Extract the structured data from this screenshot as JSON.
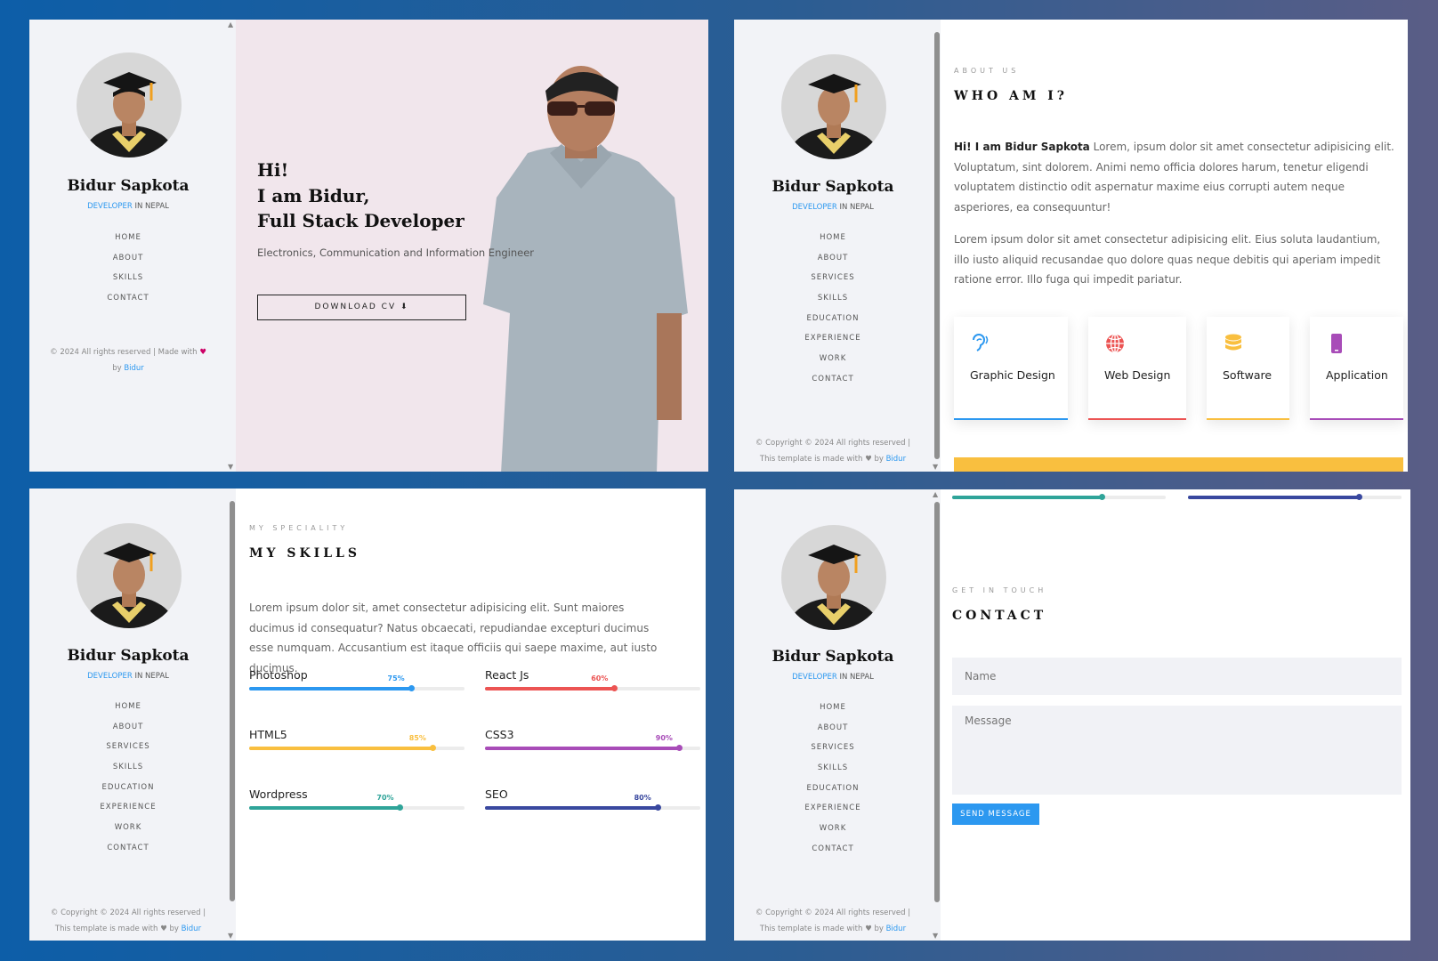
{
  "sidebar": {
    "name": "Bidur Sapkota",
    "role_highlight": "DEVELOPER",
    "role_rest": " IN NEPAL",
    "nav_short": [
      "HOME",
      "ABOUT",
      "SKILLS",
      "CONTACT"
    ],
    "nav_full": [
      "HOME",
      "ABOUT",
      "SERVICES",
      "SKILLS",
      "EDUCATION",
      "EXPERIENCE",
      "WORK",
      "CONTACT"
    ],
    "footer_short_1": "© 2024 All rights reserved | Made with",
    "footer_short_by": "by ",
    "footer_author": "Bidur",
    "footer_long_1": "© Copyright © 2024 All rights reserved |",
    "footer_long_2": "This template is made with",
    "footer_long_by": " by "
  },
  "hero": {
    "line1": "Hi!",
    "line2": "I am Bidur,",
    "line3": "Full Stack Developer",
    "subtitle": "Electronics, Communication and Information Engineer",
    "cta_label": "DOWNLOAD CV",
    "background_color": "#f1e6ec"
  },
  "about": {
    "eyebrow": "ABOUT US",
    "heading": "WHO AM I?",
    "intro_bold": "Hi! I am Bidur Sapkota",
    "para1": " Lorem, ipsum dolor sit amet consectetur adipisicing elit. Voluptatum, sint dolorem. Animi nemo officia dolores harum, tenetur eligendi voluptatem distinctio odit aspernatur maxime eius corrupti autem neque asperiores, ea consequuntur!",
    "para2": "Lorem ipsum dolor sit amet consectetur adipisicing elit. Eius soluta laudantium, illo iusto aliquid recusandae quo dolore quas neque debitis qui aperiam impedit ratione error. Illo fuga qui impedit pariatur.",
    "services": [
      {
        "label": "Graphic Design",
        "icon": "ear-icon",
        "color": "#2c98f0"
      },
      {
        "label": "Web Design",
        "icon": "globe-icon",
        "color": "#ec5453"
      },
      {
        "label": "Software",
        "icon": "database-icon",
        "color": "#f9bf3f"
      },
      {
        "label": "Application",
        "icon": "phone-icon",
        "color": "#a84cb8"
      }
    ]
  },
  "skills": {
    "eyebrow": "MY SPECIALITY",
    "heading": "MY SKILLS",
    "intro": "Lorem ipsum dolor sit, amet consectetur adipisicing elit. Sunt maiores ducimus id consequatur? Natus obcaecati, repudiandae excepturi ducimus esse numquam. Accusantium est itaque officiis qui saepe maxime, aut iusto ducimus.",
    "items": [
      {
        "name": "Photoshop",
        "percent": 75,
        "label": "75%",
        "color": "#2c98f0"
      },
      {
        "name": "React Js",
        "percent": 60,
        "label": "60%",
        "color": "#ec5453"
      },
      {
        "name": "HTML5",
        "percent": 85,
        "label": "85%",
        "color": "#f9bf3f"
      },
      {
        "name": "CSS3",
        "percent": 90,
        "label": "90%",
        "color": "#a84cb8"
      },
      {
        "name": "Wordpress",
        "percent": 70,
        "label": "70%",
        "color": "#2fa499"
      },
      {
        "name": "SEO",
        "percent": 80,
        "label": "80%",
        "color": "#39489f"
      }
    ]
  },
  "contact": {
    "eyebrow": "GET IN TOUCH",
    "heading": "CONTACT",
    "name_placeholder": "Name",
    "message_placeholder": "Message",
    "submit_label": "SEND MESSAGE",
    "top_bars": [
      {
        "percent": 70,
        "color": "#2fa499"
      },
      {
        "percent": 80,
        "color": "#39489f"
      }
    ]
  }
}
